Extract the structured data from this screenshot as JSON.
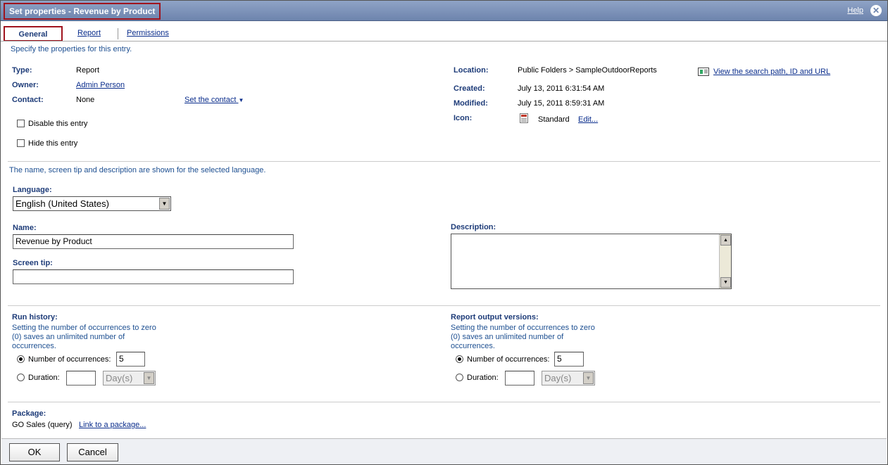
{
  "title": "Set properties - Revenue by Product",
  "help_label": "Help",
  "close_glyph": "✕",
  "tabs": [
    {
      "label": "General"
    },
    {
      "label": "Report"
    },
    {
      "label": "Permissions"
    }
  ],
  "intro": "Specify the properties for this entry.",
  "props": {
    "type_label": "Type:",
    "type_value": "Report",
    "owner_label": "Owner:",
    "owner_value": "Admin Person",
    "contact_label": "Contact:",
    "contact_value": "None",
    "set_contact_label": "Set the contact",
    "location_label": "Location:",
    "location_value": "Public Folders > SampleOutdoorReports",
    "created_label": "Created:",
    "created_value": "July 13, 2011 6:31:54 AM",
    "modified_label": "Modified:",
    "modified_value": "July 15, 2011 8:59:31 AM",
    "icon_label": "Icon:",
    "icon_value": "Standard",
    "icon_edit": "Edit...",
    "search_path_link": "View the search path, ID and URL",
    "disable_label": "Disable this entry",
    "hide_label": "Hide this entry"
  },
  "lang_note": "The name, screen tip and description are shown for the selected language.",
  "language": {
    "label": "Language:",
    "value": "English (United States)"
  },
  "name": {
    "label": "Name:",
    "value": "Revenue by Product"
  },
  "screen_tip": {
    "label": "Screen tip:",
    "value": ""
  },
  "description": {
    "label": "Description:",
    "value": ""
  },
  "run_history": {
    "label": "Run history:",
    "note1": "Setting the number of occurrences to zero",
    "note2": "(0) saves an unlimited number of",
    "note3": "occurrences.",
    "occ_label": "Number of occurrences:",
    "occ_value": "5",
    "dur_label": "Duration:",
    "dur_value": "",
    "dur_unit": "Day(s)"
  },
  "output_versions": {
    "label": "Report output versions:",
    "note1": "Setting the number of occurrences to zero",
    "note2": "(0) saves an unlimited number of",
    "note3": "occurrences.",
    "occ_label": "Number of occurrences:",
    "occ_value": "5",
    "dur_label": "Duration:",
    "dur_value": "",
    "dur_unit": "Day(s)"
  },
  "package": {
    "label": "Package:",
    "value": "GO Sales (query)",
    "link": "Link to a package..."
  },
  "buttons": {
    "ok": "OK",
    "cancel": "Cancel"
  }
}
